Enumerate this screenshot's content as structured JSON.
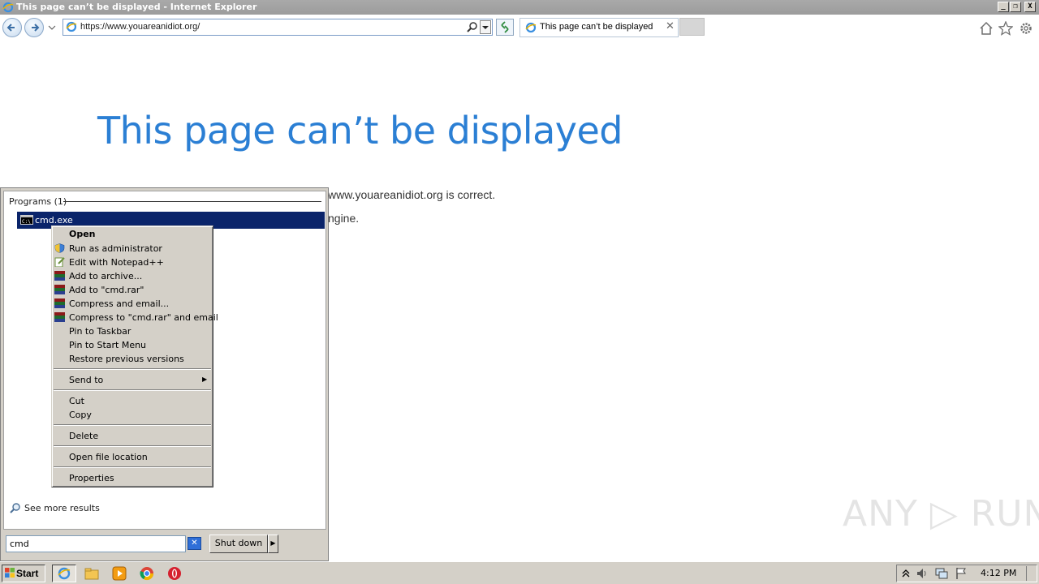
{
  "window": {
    "title": "This page can’t be displayed - Internet Explorer",
    "minimize_glyph": "_",
    "maximize_glyph": "❐",
    "close_glyph": "X"
  },
  "browser": {
    "address": "https://www.youareanidiot.org/",
    "tab_label": "This page can’t be displayed",
    "tab_close": "✕",
    "icons": [
      "back-icon",
      "forward-icon",
      "search-icon",
      "refresh-icon",
      "home-icon",
      "favorites-star-icon",
      "settings-gear-icon"
    ]
  },
  "page": {
    "heading": "This page can’t be displayed",
    "line1": "www.youareanidiot.org is correct.",
    "line2": "ngine."
  },
  "watermark": "ANY ▷ RUN",
  "start_menu": {
    "programs_label": "Programs (1)",
    "result_label": "cmd.exe",
    "see_more": "See more results",
    "search_value": "cmd",
    "clear_glyph": "✕",
    "shutdown_label": "Shut down",
    "shutdown_arrow": "▶"
  },
  "context_menu": {
    "items": [
      {
        "label": "Open",
        "bold": true
      },
      {
        "label": "Run as administrator"
      },
      {
        "label": "Edit with Notepad++"
      },
      {
        "label": "Add to archive..."
      },
      {
        "label": "Add to \"cmd.rar\""
      },
      {
        "label": "Compress and email..."
      },
      {
        "label": "Compress to \"cmd.rar\" and email"
      },
      {
        "label": "Pin to Taskbar"
      },
      {
        "label": "Pin to Start Menu"
      },
      {
        "label": "Restore previous versions"
      },
      {
        "label": "Send to"
      },
      {
        "label": "Cut"
      },
      {
        "label": "Copy"
      },
      {
        "label": "Delete"
      },
      {
        "label": "Open file location"
      },
      {
        "label": "Properties"
      }
    ],
    "submenu_arrow": "▶"
  },
  "taskbar": {
    "start_label": "Start",
    "apps": [
      "internet-explorer-icon",
      "file-explorer-icon",
      "media-player-icon",
      "chrome-icon",
      "opera-icon"
    ],
    "tray_icons": [
      "show-hidden-icon",
      "volume-icon",
      "network-icon",
      "action-center-flag-icon"
    ],
    "clock": "4:12 PM"
  },
  "colors": {
    "heading_blue": "#2b7fd4",
    "selection_navy": "#0a246a",
    "classic_gray": "#d4d0c8"
  }
}
